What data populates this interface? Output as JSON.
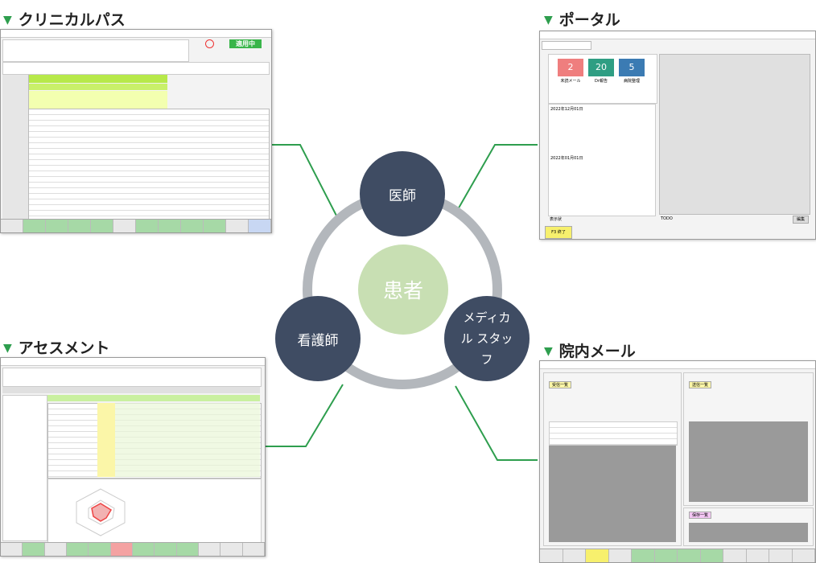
{
  "sections": {
    "clinical_path": {
      "title": "クリニカルパス",
      "status_button": "適用中"
    },
    "portal": {
      "title": "ポータル",
      "tiles": [
        {
          "value": "2",
          "label": "未読メール",
          "color": "#ef7e7e"
        },
        {
          "value": "20",
          "label": "Dr報告",
          "color": "#2f9e83"
        },
        {
          "value": "5",
          "label": "病院整理",
          "color": "#3b7bb3"
        }
      ],
      "notice_date_1": "2022年12月01日",
      "notice_date_2": "2022年01月01日",
      "f_key": "F3 終了",
      "todo_label": "TODO",
      "display_label": "表示状",
      "edit_button": "編集"
    },
    "assessment": {
      "title": "アセスメント"
    },
    "mail": {
      "title": "院内メール",
      "received_label": "受信一覧",
      "sent_label": "送信一覧",
      "draft_label": "保存一覧"
    }
  },
  "diagram": {
    "center": "患者",
    "nodes": [
      {
        "label": "医師"
      },
      {
        "label": "看護師"
      },
      {
        "label": "メディカル スタッフ"
      }
    ],
    "colors": {
      "node": "#3f4c63",
      "center": "#c8dfb3",
      "ring": "#b3b7bc",
      "connector": "#2e9e4e"
    }
  }
}
